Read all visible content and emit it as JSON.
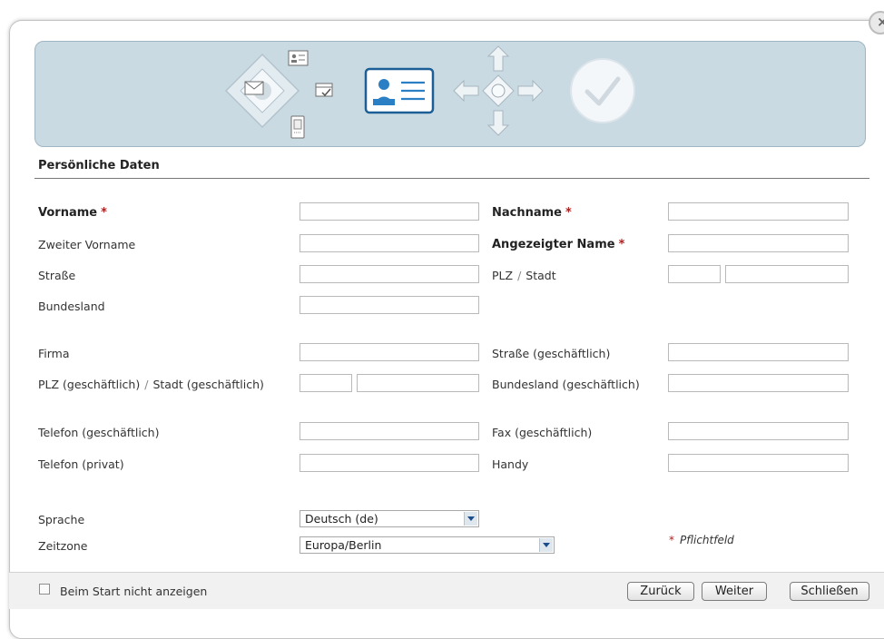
{
  "close_label": "×",
  "section_title": "Persönliche Daten",
  "required_marker": "*",
  "fields": {
    "vorname": "Vorname",
    "nachname": "Nachname",
    "zweiter_vorname": "Zweiter Vorname",
    "angezeigter_name": "Angezeigter Name",
    "strasse": "Straße",
    "plz": "PLZ",
    "plz_stadt_separator": "/",
    "stadt": "Stadt",
    "bundesland": "Bundesland",
    "firma": "Firma",
    "strasse_geschaeftlich": "Straße (geschäftlich)",
    "plz_geschaeftlich": "PLZ (geschäftlich)",
    "stadt_geschaeftlich": "Stadt (geschäftlich)",
    "bundesland_geschaeftlich": "Bundesland (geschäftlich)",
    "telefon_geschaeftlich": "Telefon (geschäftlich)",
    "fax_geschaeftlich": "Fax (geschäftlich)",
    "telefon_privat": "Telefon (privat)",
    "handy": "Handy",
    "sprache": "Sprache",
    "zeitzone": "Zeitzone"
  },
  "selects": {
    "sprache_value": "Deutsch (de)",
    "zeitzone_value": "Europa/Berlin"
  },
  "required_hint": "Pflichtfeld",
  "footer": {
    "checkbox_label": "Beim Start nicht anzeigen",
    "back_button": "Zurück",
    "next_button": "Weiter",
    "close_button": "Schließen"
  },
  "colors": {
    "accent": "#1c5f96",
    "banner": "#c9dae3",
    "required": "#b02020"
  },
  "icons": [
    "mail-icon",
    "contact-card-icon",
    "schedule-icon",
    "phone-icon",
    "active-contact-card-icon",
    "connect-arrows-icon",
    "done-check-icon"
  ]
}
